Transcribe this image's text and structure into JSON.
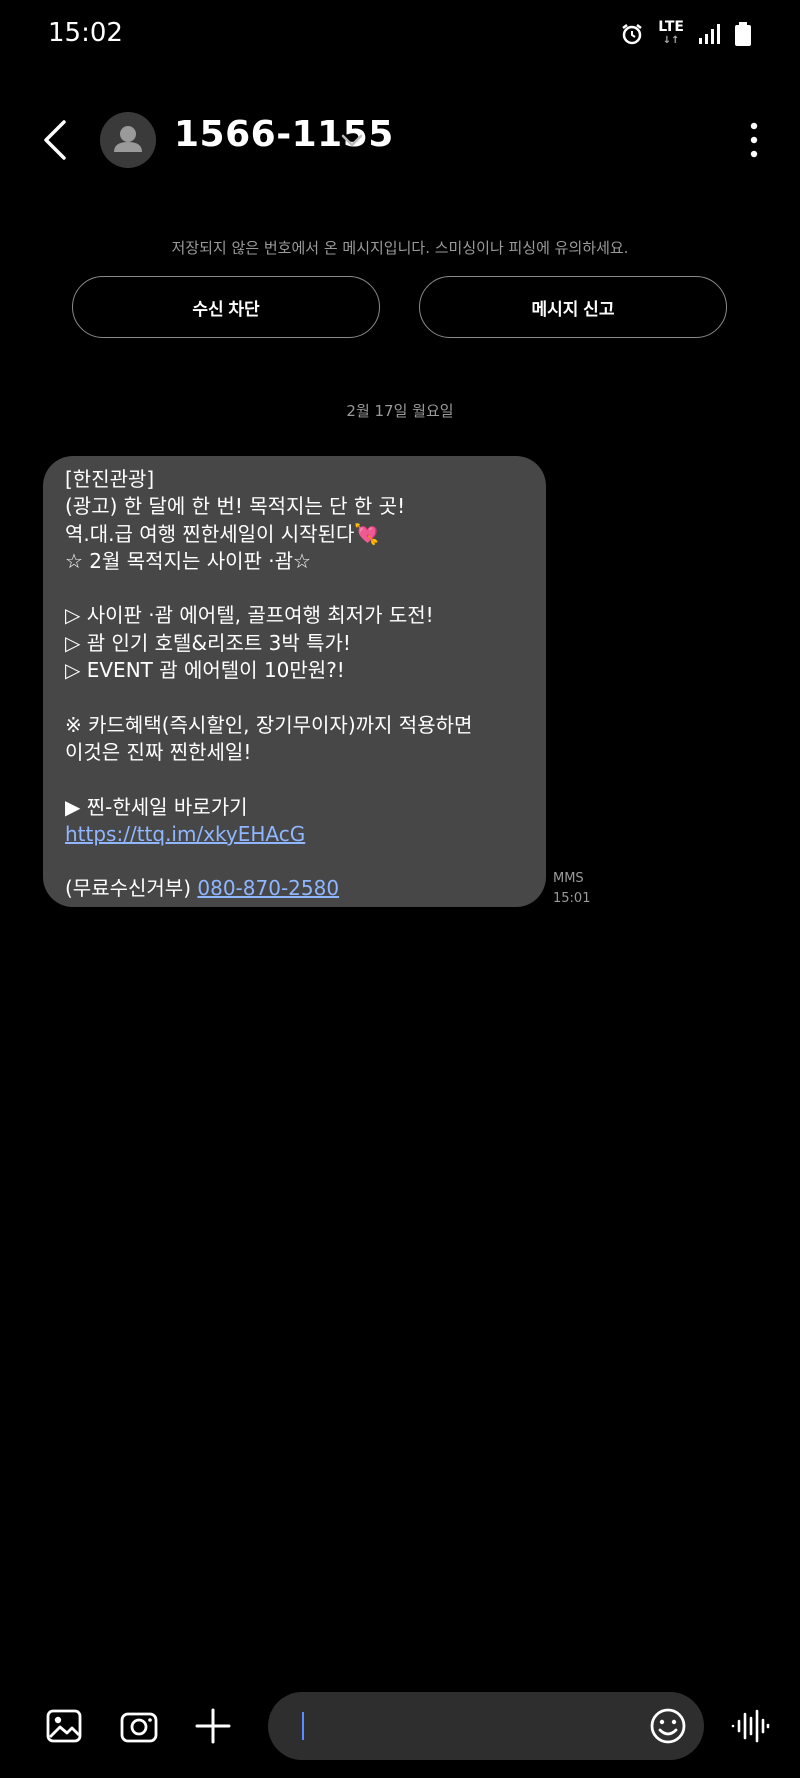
{
  "status": {
    "time": "15:02",
    "network": "LTE"
  },
  "header": {
    "contact": "1566-1155"
  },
  "warning": "저장되지 않은 번호에서 온 메시지입니다. 스미싱이나 피싱에 유의하세요.",
  "actions": {
    "block_label": "수신 차단",
    "report_label": "메시지 신고"
  },
  "date_separator": "2월 17일 월요일",
  "message": {
    "lines": [
      "[한진관광]",
      "(광고) 한 달에 한 번! 목적지는 단 한 곳!",
      "역.대.급 여행 찐한세일이 시작된다💘",
      "☆ 2월 목적지는 사이판 ·괌☆",
      "",
      "▷ 사이판 ·괌 에어텔, 골프여행 최저가 도전!",
      "▷ 괌 인기 호텔&리조트 3박 특가!",
      "▷ EVENT 괌 에어텔이 10만원?!",
      "",
      "※ 카드혜택(즉시할인, 장기무이자)까지 적용하면",
      "이것은 진짜 찐한세일!",
      "",
      "▶ 찐-한세일 바로가기"
    ],
    "link_url": "https://ttq.im/xkyEHAcG",
    "optout_prefix": "(무료수신거부) ",
    "optout_number": "080-870-2580",
    "type": "MMS",
    "time": "15:01"
  },
  "colors": {
    "bubble": "#474747",
    "link": "#8fb6ff",
    "background": "#000000"
  }
}
